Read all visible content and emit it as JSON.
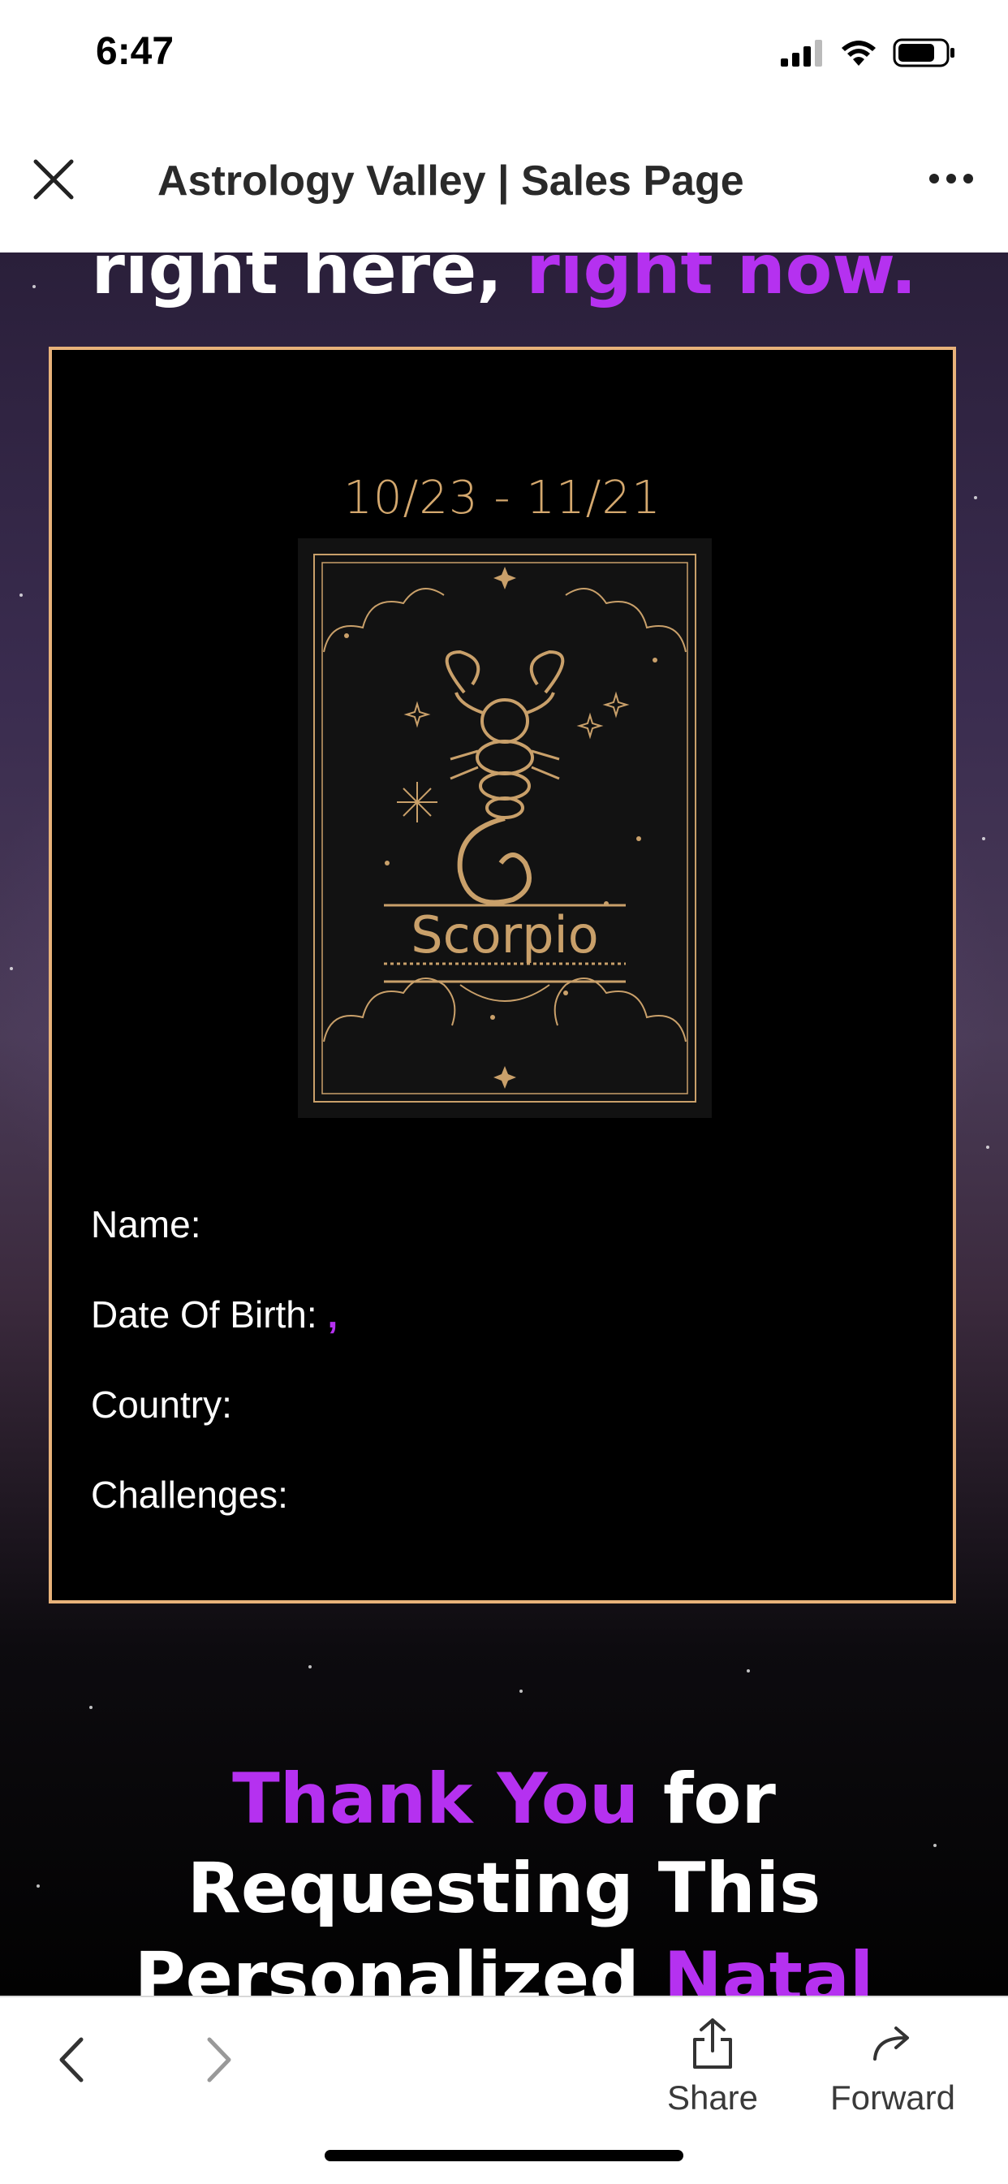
{
  "status_bar": {
    "time": "6:47",
    "signal_icon": "cellular-signal-icon",
    "wifi_icon": "wifi-icon",
    "battery_icon": "battery-icon"
  },
  "nav": {
    "title": "Astrology Valley | Sales Page",
    "close_icon": "close-icon",
    "more_icon": "more-options-icon"
  },
  "page": {
    "headline_white": "right here, ",
    "headline_purple": "right now.",
    "card": {
      "dates": "10/23 - 11/21",
      "sign_name": "Scorpio",
      "fields": [
        {
          "label": "Name:"
        },
        {
          "label": "Date Of Birth:",
          "value": ","
        },
        {
          "label": "Country:"
        },
        {
          "label": "Challenges:"
        }
      ]
    },
    "thanks": {
      "line1_purple": "Thank You",
      "line1_white": " for",
      "line2": "Requesting This",
      "line3_white": "Personalized ",
      "line3_purple": "Natal"
    }
  },
  "toolbar": {
    "share_label": "Share",
    "forward_label": "Forward",
    "back_icon": "back-chevron-icon",
    "forward_icon": "forward-chevron-icon"
  },
  "colors": {
    "accent_purple": "#b531f0",
    "gold": "#e8b27a"
  }
}
